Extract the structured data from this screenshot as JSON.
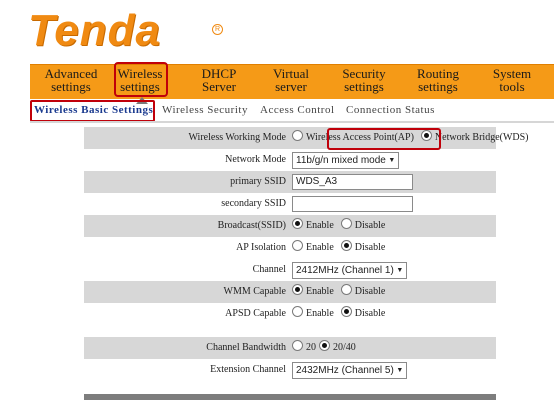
{
  "brand": {
    "logo_text": "Tenda",
    "reg_mark": "R",
    "orange": "#f59a17",
    "highlight": "#c0000a"
  },
  "menu": {
    "items": [
      {
        "line1": "Advanced",
        "line2": "settings"
      },
      {
        "line1": "Wireless",
        "line2": "settings"
      },
      {
        "line1": "DHCP",
        "line2": "Server"
      },
      {
        "line1": "Virtual",
        "line2": "server"
      },
      {
        "line1": "Security",
        "line2": "settings"
      },
      {
        "line1": "Routing",
        "line2": "settings"
      },
      {
        "line1": "System",
        "line2": "tools"
      }
    ],
    "active": "Wireless settings"
  },
  "submenu": {
    "items": [
      "Wireless Basic Settings",
      "Wireless Security",
      "Access Control",
      "Connection Status"
    ],
    "active": "Wireless Basic Settings"
  },
  "form": {
    "working_mode": {
      "label": "Wireless Working Mode",
      "opt_ap": "Wireless Access Point(AP)",
      "opt_wds": "Network Bridge(WDS)",
      "selected": "Network Bridge(WDS)"
    },
    "network_mode": {
      "label": "Network Mode",
      "value": "11b/g/n mixed mode"
    },
    "primary_ssid": {
      "label": "primary SSID",
      "value": "WDS_A3"
    },
    "secondary_ssid": {
      "label": "secondary SSID",
      "value": ""
    },
    "broadcast": {
      "label": "Broadcast(SSID)",
      "opt_enable": "Enable",
      "opt_disable": "Disable",
      "selected": "Enable"
    },
    "ap_isolation": {
      "label": "AP Isolation",
      "opt_enable": "Enable",
      "opt_disable": "Disable",
      "selected": "Disable"
    },
    "channel": {
      "label": "Channel",
      "value": "2412MHz (Channel 1)"
    },
    "wmm": {
      "label": "WMM Capable",
      "opt_enable": "Enable",
      "opt_disable": "Disable",
      "selected": "Enable"
    },
    "apsd": {
      "label": "APSD Capable",
      "opt_enable": "Enable",
      "opt_disable": "Disable",
      "selected": "Disable"
    },
    "bandwidth": {
      "label": "Channel Bandwidth",
      "opt_20": "20",
      "opt_2040": "20/40",
      "selected": "20/40"
    },
    "ext_channel": {
      "label": "Extension Channel",
      "value": "2432MHz (Channel 5)"
    }
  },
  "icons": {
    "dropdown": "chevron-down-icon",
    "radio": "radio-icon"
  }
}
